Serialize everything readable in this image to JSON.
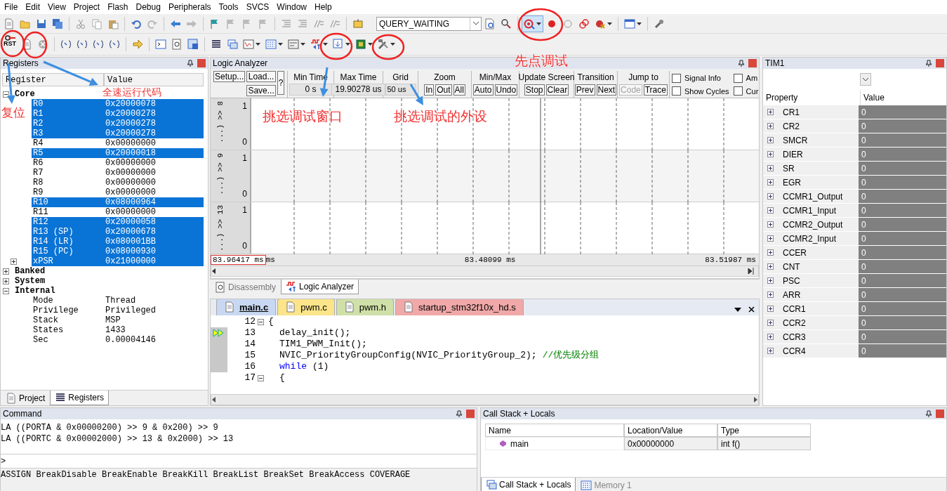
{
  "menu": [
    "File",
    "Edit",
    "View",
    "Project",
    "Flash",
    "Debug",
    "Peripherals",
    "Tools",
    "SVCS",
    "Window",
    "Help"
  ],
  "toolbar": {
    "target": "QUERY_WAITING",
    "reset_label": "RST"
  },
  "registers_panel": {
    "title": "Registers",
    "columns": [
      "Register",
      "Value"
    ],
    "tree": [
      {
        "label": "Core",
        "expanded": true,
        "children": [
          {
            "label": "R0",
            "value": "0x20000078",
            "selected": true
          },
          {
            "label": "R1",
            "value": "0x20000278",
            "selected": true
          },
          {
            "label": "R2",
            "value": "0x20000278",
            "selected": true
          },
          {
            "label": "R3",
            "value": "0x20000278",
            "selected": true
          },
          {
            "label": "R4",
            "value": "0x00000000",
            "selected": false
          },
          {
            "label": "R5",
            "value": "0x20000018",
            "selected": true
          },
          {
            "label": "R6",
            "value": "0x00000000",
            "selected": false
          },
          {
            "label": "R7",
            "value": "0x00000000",
            "selected": false
          },
          {
            "label": "R8",
            "value": "0x00000000",
            "selected": false
          },
          {
            "label": "R9",
            "value": "0x00000000",
            "selected": false
          },
          {
            "label": "R10",
            "value": "0x08000964",
            "selected": true
          },
          {
            "label": "R11",
            "value": "0x00000000",
            "selected": false
          },
          {
            "label": "R12",
            "value": "0x20000058",
            "selected": true
          },
          {
            "label": "R13 (SP)",
            "value": "0x20000678",
            "selected": true
          },
          {
            "label": "R14 (LR)",
            "value": "0x080001BB",
            "selected": true
          },
          {
            "label": "R15 (PC)",
            "value": "0x08000930",
            "selected": true
          },
          {
            "label": "xPSR",
            "value": "0x21000000",
            "selected": true,
            "expanded": false
          }
        ]
      },
      {
        "label": "Banked",
        "expanded": false
      },
      {
        "label": "System",
        "expanded": false
      },
      {
        "label": "Internal",
        "expanded": true,
        "children": [
          {
            "label": "Mode",
            "value": "Thread",
            "selected": false
          },
          {
            "label": "Privilege",
            "value": "Privileged",
            "selected": false
          },
          {
            "label": "Stack",
            "value": "MSP",
            "selected": false
          },
          {
            "label": "States",
            "value": "1433",
            "selected": false
          },
          {
            "label": "Sec",
            "value": "0.00004146",
            "selected": false
          }
        ]
      }
    ],
    "tabs": [
      {
        "label": "Project",
        "selected": false
      },
      {
        "label": "Registers",
        "selected": true
      }
    ]
  },
  "logic_analyzer": {
    "title": "Logic Analyzer",
    "groups": [
      {
        "kind": "setup",
        "buttons": [
          {
            "label": "Setup...",
            "disabled": false
          },
          {
            "label": "Load...",
            "disabled": false
          },
          {
            "label": "Save...",
            "disabled": false
          }
        ],
        "help": "?"
      },
      {
        "kind": "readout",
        "title": "Min Time",
        "value": "0 s"
      },
      {
        "kind": "readout",
        "title": "Max Time",
        "value": "19.90278 us"
      },
      {
        "kind": "readout",
        "title": "Grid",
        "value": "50 us"
      },
      {
        "kind": "buttons",
        "title": "Zoom",
        "buttons": [
          {
            "label": "In",
            "disabled": false
          },
          {
            "label": "Out",
            "disabled": false
          },
          {
            "label": "All",
            "disabled": false
          }
        ]
      },
      {
        "kind": "buttons",
        "title": "Min/Max",
        "buttons": [
          {
            "label": "Auto",
            "disabled": false
          },
          {
            "label": "Undo",
            "disabled": false
          }
        ]
      },
      {
        "kind": "buttons",
        "title": "Update Screen",
        "buttons": [
          {
            "label": "Stop",
            "disabled": false
          },
          {
            "label": "Clear",
            "disabled": false
          }
        ]
      },
      {
        "kind": "buttons",
        "title": "Transition",
        "buttons": [
          {
            "label": "Prev",
            "disabled": false
          },
          {
            "label": "Next",
            "disabled": false
          }
        ]
      },
      {
        "kind": "buttons",
        "title": "Jump to",
        "buttons": [
          {
            "label": "Code",
            "disabled": true
          },
          {
            "label": "Trace",
            "disabled": false
          }
        ]
      },
      {
        "kind": "checks",
        "items": [
          {
            "label": "Signal Info",
            "checked": false
          },
          {
            "label": "Show Cycles",
            "checked": false
          },
          {
            "label": "Am",
            "checked": false
          },
          {
            "label": "Cur",
            "checked": false
          }
        ]
      }
    ],
    "signals": [
      {
        "label": "...) >> 8",
        "high": "1",
        "low": "0"
      },
      {
        "label": "...) >> 9",
        "high": "1",
        "low": "0"
      },
      {
        "label": "...) >> 13",
        "high": "1",
        "low": "0"
      }
    ],
    "cursor_time": "83.96417 ms",
    "start_time": "ms",
    "middle_time": "83.48099 ms",
    "end_time": "83.51987 ms"
  },
  "view_tabs": [
    {
      "label": "Disassembly",
      "selected": false
    },
    {
      "label": "Logic Analyzer",
      "selected": true
    }
  ],
  "editor": {
    "tabs": [
      {
        "label": "main.c",
        "selected": true,
        "color": "#c9d8f2"
      },
      {
        "label": "pwm.c",
        "selected": false,
        "color": "#fbe48a"
      },
      {
        "label": "pwm.h",
        "selected": false,
        "color": "#cfe0a8"
      },
      {
        "label": "startup_stm32f10x_hd.s",
        "selected": false,
        "color": "#f0a8a8"
      }
    ],
    "lines": [
      {
        "number": "12",
        "fold_collapsed": false,
        "indented": false,
        "current": false,
        "executable": false,
        "segments": [
          {
            "kind": "plain",
            "text": "{"
          }
        ]
      },
      {
        "number": "13",
        "indented": true,
        "current": true,
        "executable": true,
        "segments": [
          {
            "kind": "plain",
            "text": "delay_init();"
          }
        ]
      },
      {
        "number": "14",
        "indented": true,
        "current": false,
        "executable": true,
        "segments": [
          {
            "kind": "plain",
            "text": "TIM1_PWM_Init();"
          }
        ]
      },
      {
        "number": "15",
        "indented": true,
        "current": false,
        "executable": true,
        "segments": [
          {
            "kind": "plain",
            "text": "NVIC_PriorityGroupConfig(NVIC_PriorityGroup_2);"
          },
          {
            "kind": "comment",
            "text": "//优先级分组"
          }
        ]
      },
      {
        "number": "16",
        "indented": true,
        "current": false,
        "executable": true,
        "segments": [
          {
            "kind": "keyword",
            "text": "while"
          },
          {
            "kind": "plain",
            "text": "(1)"
          }
        ]
      },
      {
        "number": "17",
        "fold_collapsed": false,
        "indented": true,
        "current": false,
        "executable": false,
        "segments": [
          {
            "kind": "plain",
            "text": "{"
          }
        ]
      }
    ]
  },
  "tim1_panel": {
    "title": "TIM1",
    "columns": [
      "Property",
      "Value"
    ],
    "rows": [
      {
        "name": "CR1",
        "value": "0"
      },
      {
        "name": "CR2",
        "value": "0"
      },
      {
        "name": "SMCR",
        "value": "0"
      },
      {
        "name": "DIER",
        "value": "0"
      },
      {
        "name": "SR",
        "value": "0"
      },
      {
        "name": "EGR",
        "value": "0"
      },
      {
        "name": "CCMR1_Output",
        "value": "0"
      },
      {
        "name": "CCMR1_Input",
        "value": "0"
      },
      {
        "name": "CCMR2_Output",
        "value": "0"
      },
      {
        "name": "CCMR2_Input",
        "value": "0"
      },
      {
        "name": "CCER",
        "value": "0"
      },
      {
        "name": "CNT",
        "value": "0"
      },
      {
        "name": "PSC",
        "value": "0"
      },
      {
        "name": "ARR",
        "value": "0"
      },
      {
        "name": "CCR1",
        "value": "0"
      },
      {
        "name": "CCR2",
        "value": "0"
      },
      {
        "name": "CCR3",
        "value": "0"
      },
      {
        "name": "CCR4",
        "value": "0"
      }
    ]
  },
  "command_panel": {
    "title": "Command",
    "lines": [
      "LA ((PORTA & 0x00000200) >> 9 & 0x200) >> 9",
      "LA ((PORTC & 0x00002000) >> 13 & 0x2000) >> 13"
    ],
    "prompt": ">",
    "hint": "ASSIGN BreakDisable BreakEnable BreakKill BreakList BreakSet BreakAccess COVERAGE"
  },
  "call_stack_panel": {
    "title": "Call Stack + Locals",
    "columns": [
      "Name",
      "Location/Value",
      "Type"
    ],
    "rows": [
      {
        "name": "main",
        "value": "0x00000000",
        "type": "int f()"
      }
    ],
    "tabs": [
      {
        "label": "Call Stack + Locals",
        "selected": true
      },
      {
        "label": "Memory 1",
        "selected": false
      }
    ]
  },
  "annotations": [
    {
      "text": "复位"
    },
    {
      "text": "全速运行代码"
    },
    {
      "text": "先点调试"
    },
    {
      "text": "挑选调试窗口"
    },
    {
      "text": "挑选调试的外设"
    }
  ]
}
